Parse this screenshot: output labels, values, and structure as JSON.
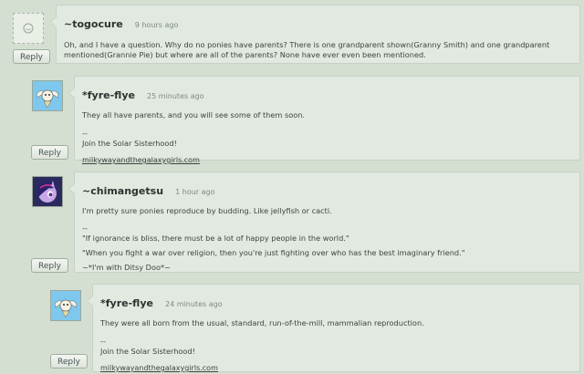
{
  "reply_label": "Reply",
  "comments": [
    {
      "author": "~togocure",
      "time": "9 hours ago",
      "avatar": "blank-avatar-icon",
      "body": "Oh, and I have a question. Why do no ponies have parents? There is one grandparent shown(Granny Smith) and one grandparent mentioned(Grannie Pie) but where are all of the parents? None have ever even been mentioned."
    },
    {
      "author": "*fyre-flye",
      "time": "25 minutes ago",
      "avatar": "winged-pony-avatar",
      "body": "They all have parents, and you will see some of them soon.",
      "sig_sep": "--",
      "sig_line": "Join the Solar Sisterhood!",
      "link": "milkywayandthegalaxygirls.com"
    },
    {
      "author": "~chimangetsu",
      "time": "1 hour ago",
      "avatar": "twilight-pony-avatar",
      "body": "I'm pretty sure ponies reproduce by budding. Like jellyfish or cacti.",
      "sig_sep": "--",
      "quote1": "\"If ignorance is bliss, there must be a lot of happy people in the world.\"",
      "quote2": "\"When you fight a war over religion, then you're just fighting over who has the best imaginary friend.\"",
      "sig_line": "~*I'm with Ditsy Doo*~"
    },
    {
      "author": "*fyre-flye",
      "time": "24 minutes ago",
      "avatar": "winged-pony-avatar",
      "body": "They were all born from the usual, standard, run-of-the-mill, mammalian reproduction.",
      "sig_sep": "--",
      "sig_line": "Join the Solar Sisterhood!",
      "link": "milkywayandthegalaxygirls.com"
    }
  ]
}
